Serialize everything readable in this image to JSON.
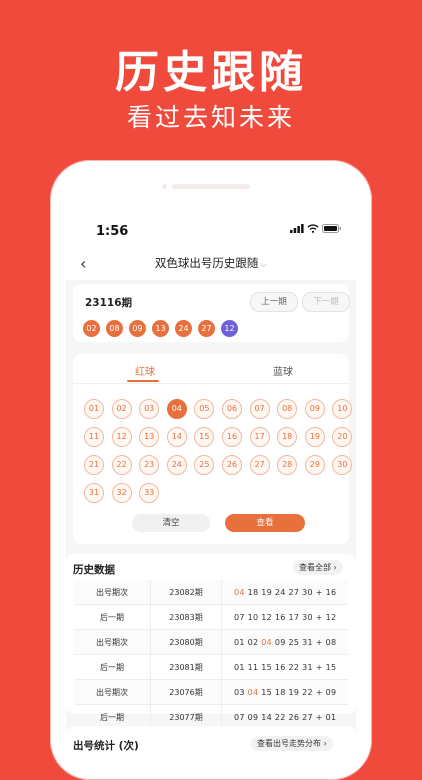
{
  "hero": {
    "title": "历史跟随",
    "subtitle": "看过去知未来"
  },
  "status": {
    "time": "1:56"
  },
  "nav": {
    "title": "双色球出号历史跟随"
  },
  "latest": {
    "issue": "23116期",
    "prev_label": "上一期",
    "next_label": "下一期",
    "red": [
      "02",
      "08",
      "09",
      "13",
      "24",
      "27"
    ],
    "blue": "12"
  },
  "picker": {
    "tab_red": "红球",
    "tab_blue": "蓝球",
    "numbers": [
      "01",
      "02",
      "03",
      "04",
      "05",
      "06",
      "07",
      "08",
      "09",
      "10",
      "11",
      "12",
      "13",
      "14",
      "15",
      "16",
      "17",
      "18",
      "19",
      "20",
      "21",
      "22",
      "23",
      "24",
      "25",
      "26",
      "27",
      "28",
      "29",
      "30",
      "31",
      "32",
      "33"
    ],
    "selected": [
      "04"
    ],
    "clear_label": "清空",
    "view_label": "查看"
  },
  "history": {
    "title": "历史数据",
    "view_all": "查看全部",
    "rows": [
      {
        "type": "出号期次",
        "issue": "23082期",
        "reds": [
          "04",
          "18",
          "19",
          "24",
          "27",
          "30"
        ],
        "blue": "16"
      },
      {
        "type": "后一期",
        "issue": "23083期",
        "reds": [
          "07",
          "10",
          "12",
          "16",
          "17",
          "30"
        ],
        "blue": "12"
      },
      {
        "type": "出号期次",
        "issue": "23080期",
        "reds": [
          "01",
          "02",
          "04",
          "09",
          "25",
          "31"
        ],
        "blue": "08"
      },
      {
        "type": "后一期",
        "issue": "23081期",
        "reds": [
          "01",
          "11",
          "15",
          "16",
          "22",
          "31"
        ],
        "blue": "15"
      },
      {
        "type": "出号期次",
        "issue": "23076期",
        "reds": [
          "03",
          "04",
          "15",
          "18",
          "19",
          "22"
        ],
        "blue": "09"
      },
      {
        "type": "后一期",
        "issue": "23077期",
        "reds": [
          "07",
          "09",
          "14",
          "22",
          "26",
          "27"
        ],
        "blue": "01"
      }
    ]
  },
  "stats": {
    "title": "出号统计 (次)",
    "link": "查看出号走势分布"
  },
  "colors": {
    "background": "#f04a3d",
    "accent": "#e8703d",
    "blue_ball": "#6f5fd8"
  }
}
